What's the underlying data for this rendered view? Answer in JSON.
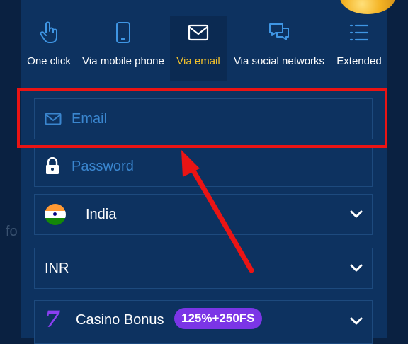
{
  "backdrop": {
    "side_text": "fo"
  },
  "tabs": [
    {
      "label": "One click",
      "icon": "hand-pointer-icon",
      "active": false
    },
    {
      "label": "Via mobile phone",
      "icon": "mobile-phone-icon",
      "active": false
    },
    {
      "label": "Via email",
      "icon": "envelope-icon",
      "active": true
    },
    {
      "label": "Via social networks",
      "icon": "chat-bubbles-icon",
      "active": false
    },
    {
      "label": "Extended",
      "icon": "list-icon",
      "active": false
    }
  ],
  "form": {
    "email": {
      "placeholder": "Email",
      "icon": "envelope-icon"
    },
    "password": {
      "placeholder": "Password",
      "icon": "lock-icon"
    },
    "country": {
      "value": "India",
      "icon": "india-flag-icon"
    },
    "currency": {
      "value": "INR"
    },
    "bonus": {
      "label": "Casino Bonus",
      "badge": "125%+250FS",
      "icon": "casino-seven-icon"
    }
  },
  "colors": {
    "background": "#0a2141",
    "panel": "#0d3260",
    "active_tab_text": "#f3c12c",
    "placeholder": "#3a86cf",
    "highlight": "#ea1414",
    "badge": "#7b35e6"
  }
}
